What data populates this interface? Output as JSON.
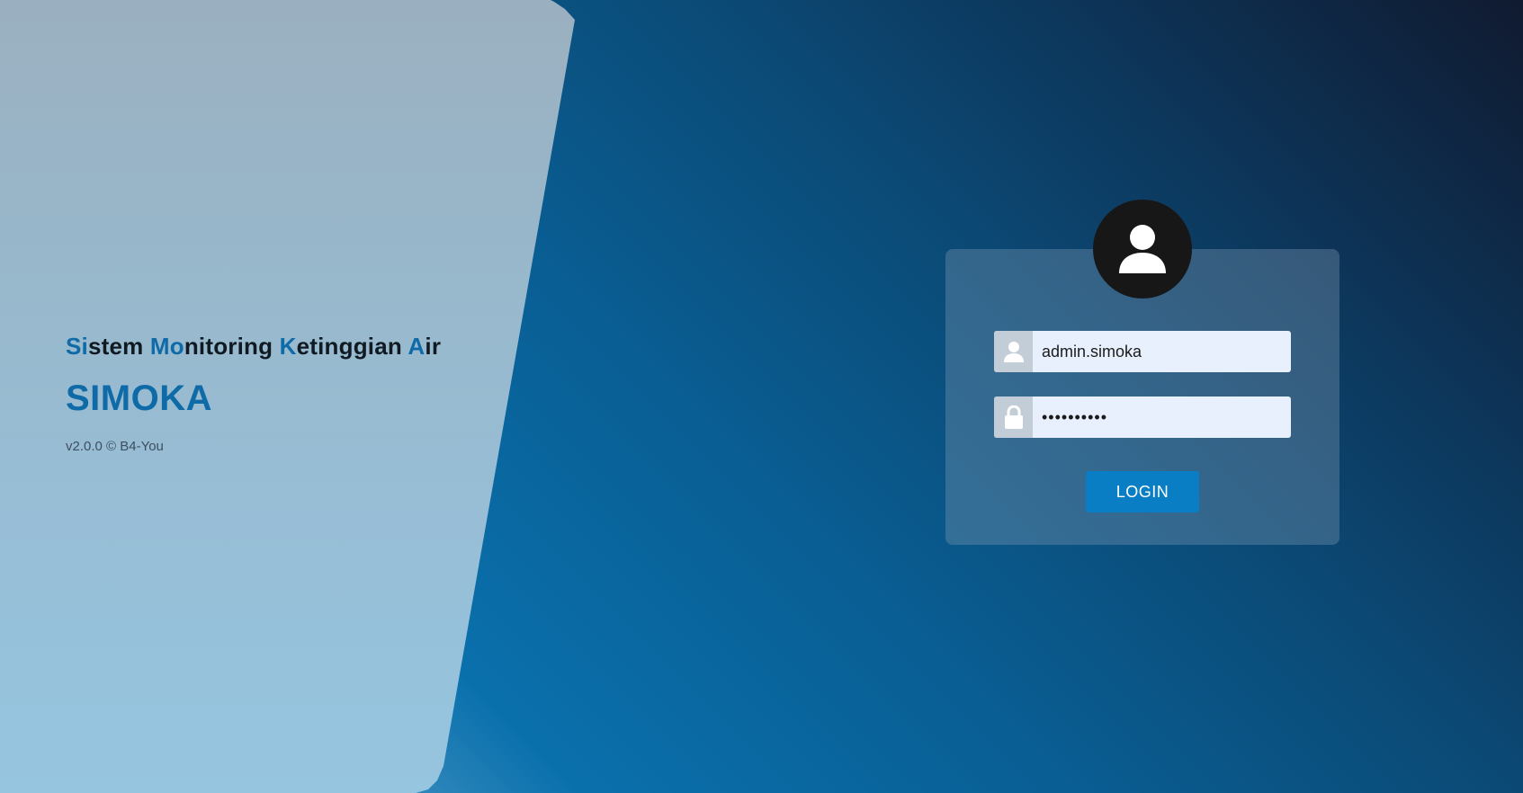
{
  "brand": {
    "tagline_parts": [
      {
        "text": "Si",
        "highlight": true
      },
      {
        "text": "stem ",
        "highlight": false
      },
      {
        "text": "Mo",
        "highlight": true
      },
      {
        "text": "nitoring ",
        "highlight": false
      },
      {
        "text": "K",
        "highlight": true
      },
      {
        "text": "etinggian ",
        "highlight": false
      },
      {
        "text": "A",
        "highlight": true
      },
      {
        "text": "ir",
        "highlight": false
      }
    ],
    "title": "SIMOKA",
    "version": "v2.0.0 © B4-You"
  },
  "login": {
    "avatar_icon": "user-icon",
    "username": {
      "value": "admin.simoka",
      "icon": "user-icon"
    },
    "password": {
      "value": "••••••••••",
      "icon": "lock-icon"
    },
    "submit_label": "LOGIN"
  },
  "colors": {
    "accent": "#0f6aa8",
    "button": "#0a7ec4",
    "avatar_bg": "#171717",
    "input_bg": "#e8f0fe"
  }
}
